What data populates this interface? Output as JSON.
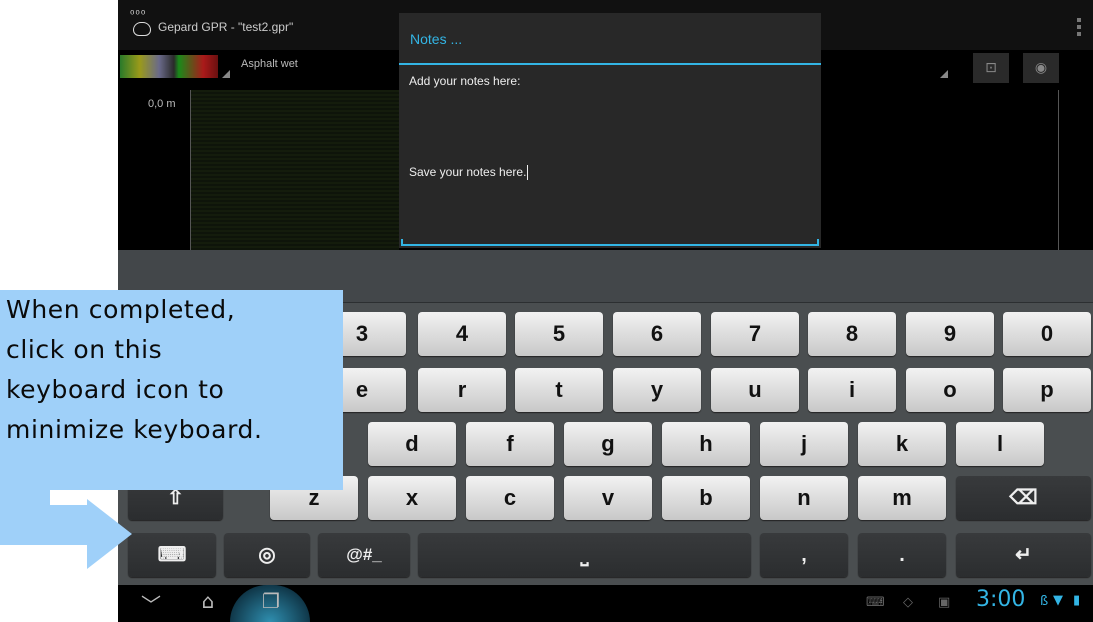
{
  "app": {
    "title": "Gepard GPR - \"test2.gpr\""
  },
  "toolbar": {
    "material": "Asphalt wet"
  },
  "chart": {
    "depth_label": "0,0 m"
  },
  "dialog": {
    "title": "Notes ...",
    "prompt": "Add your notes here:",
    "input_value": "Save your notes here."
  },
  "keyboard": {
    "row1": [
      "3",
      "4",
      "5",
      "6",
      "7",
      "8",
      "9",
      "0"
    ],
    "row2": [
      "e",
      "r",
      "t",
      "y",
      "u",
      "i",
      "o",
      "p"
    ],
    "row3": [
      "d",
      "f",
      "g",
      "h",
      "j",
      "k",
      "l"
    ],
    "row4": [
      "z",
      "x",
      "c",
      "v",
      "b",
      "n",
      "m"
    ],
    "shift": "⇧",
    "backspace": "⌫",
    "symbols": "@#_",
    "comma": ",",
    "period": ".",
    "enter": "↵",
    "hide": "⌨",
    "globe": "◎",
    "space": "⎵"
  },
  "statusbar": {
    "time": "3:00"
  },
  "navbar": {
    "back": "﹀",
    "home": "⌂",
    "recents": "❐"
  },
  "callout": {
    "line1": "When completed,",
    "line2": "click on this",
    "line3": "keyboard icon to",
    "line4": "minimize keyboard."
  },
  "colors": {
    "accent": "#33b5e5",
    "callout": "#9fd0f9"
  }
}
